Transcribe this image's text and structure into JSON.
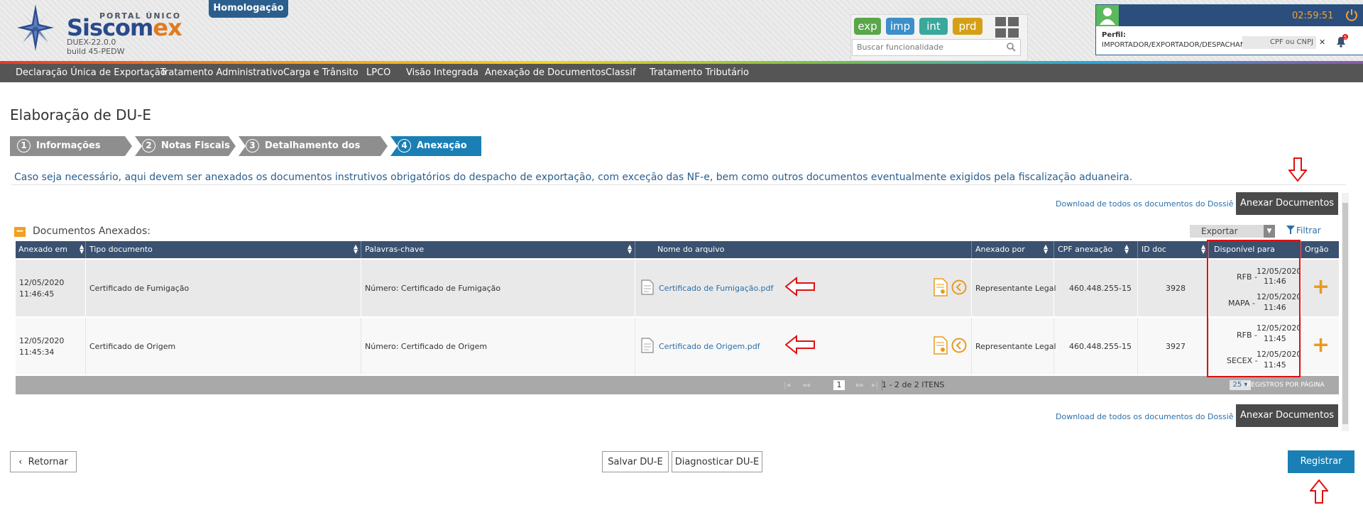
{
  "header": {
    "portal": "PORTAL ÚNICO",
    "brand_a": "Siscom",
    "brand_b": "ex",
    "version": "DUEX-22.0.0",
    "build": "build 45-PEDW",
    "environment_badge": "Homologação",
    "env_buttons": [
      {
        "label": "exp",
        "color": "#5aa64a"
      },
      {
        "label": "imp",
        "color": "#3d8fc9"
      },
      {
        "label": "int",
        "color": "#3aa89a"
      },
      {
        "label": "prd",
        "color": "#d4a017"
      }
    ],
    "search_placeholder": "Buscar funcionalidade",
    "session_timer": "02:59:51",
    "perfil_label": "Perfil:",
    "perfil_value": "IMPORTADOR/EXPORTADOR/DESPACHANTE",
    "cpf_placeholder": "CPF ou CNPJ",
    "notifications": "5"
  },
  "menu": [
    "Declaração Única de Exportação",
    "Tratamento Administrativo",
    "Carga e Trânsito",
    "LPCO",
    "Visão Integrada",
    "Anexação de Documentos",
    "Classif",
    "Tratamento Tributário"
  ],
  "page": {
    "title": "Elaboração de DU-E",
    "steps": [
      {
        "num": "1",
        "label": "Informações Gerais"
      },
      {
        "num": "2",
        "label": "Notas Fiscais"
      },
      {
        "num": "3",
        "label": "Detalhamento dos Itens"
      },
      {
        "num": "4",
        "label": "Anexação"
      }
    ],
    "active_step": 4,
    "info_text": "Caso seja necessário, aqui devem ser anexados os documentos instrutivos obrigatórios do despacho de exportação, com exceção das NF-e, bem como outros documentos eventualmente exigidos pela fiscalização aduaneira.",
    "download_all": "Download de todos os documentos do Dossiê",
    "attach_button": "Anexar Documentos",
    "section_title": "Documentos Anexados:",
    "export_label": "Exportar",
    "filter_label": "Filtrar"
  },
  "table": {
    "columns": [
      "Anexado em",
      "Tipo documento",
      "Palavras-chave",
      "Nome do arquivo",
      "Anexado por",
      "CPF anexação",
      "ID doc",
      "Disponível para",
      "Orgão"
    ],
    "rows": [
      {
        "date": "12/05/2020",
        "time": "11:46:45",
        "tipo": "Certificado de Fumigação",
        "palavras": "Número: Certificado de Fumigação",
        "arquivo": "Certificado de Fumigação.pdf",
        "anexado_por": "Representante Legal",
        "cpf": "460.448.255-15",
        "id": "3928",
        "disponivel": [
          {
            "org": "RFB -",
            "date": "12/05/2020",
            "time": "11:46"
          },
          {
            "org": "MAPA -",
            "date": "12/05/2020",
            "time": "11:46"
          }
        ]
      },
      {
        "date": "12/05/2020",
        "time": "11:45:34",
        "tipo": "Certificado de Origem",
        "palavras": "Número: Certificado de Origem",
        "arquivo": "Certificado de Origem.pdf",
        "anexado_por": "Representante Legal",
        "cpf": "460.448.255-15",
        "id": "3927",
        "disponivel": [
          {
            "org": "RFB -",
            "date": "12/05/2020",
            "time": "11:45"
          },
          {
            "org": "SECEX -",
            "date": "12/05/2020",
            "time": "11:45"
          }
        ]
      }
    ],
    "pager": {
      "current_page": "1",
      "summary": "1 - 2 de 2 ITENS",
      "page_size": "25",
      "page_size_label": "REGISTROS POR PÁGINA"
    }
  },
  "footer": {
    "back": "Retornar",
    "save": "Salvar DU-E",
    "diagnose": "Diagnosticar DU-E",
    "register": "Registrar"
  }
}
